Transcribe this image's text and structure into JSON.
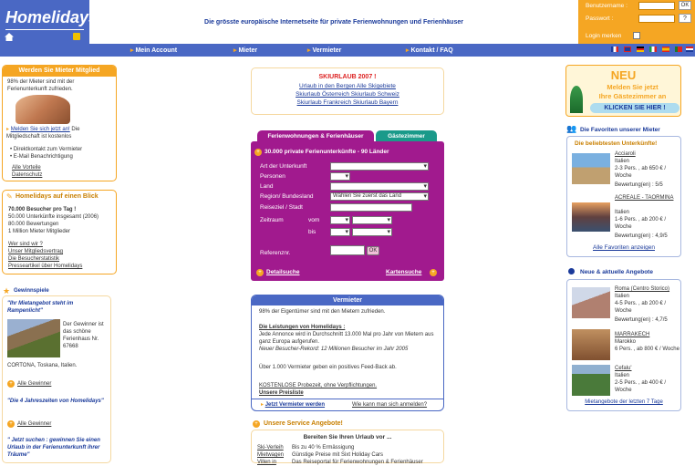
{
  "header": {
    "logo_text": "Homelidays",
    "tagline": "Die grösste europäische Internetseite für private Ferienwohnungen und Ferienhäuser",
    "login": {
      "username_label": "Benutzername :",
      "password_label": "Passwort :",
      "remember_label": "Login merken",
      "ok": "OK",
      "help": "?"
    }
  },
  "nav": [
    "Mein Account",
    "Mieter",
    "Vermieter",
    "Kontakt / FAQ"
  ],
  "left": {
    "member_box": {
      "title": "Werden Sie Mieter Mitglied",
      "intro": "98% der Mieter sind mit der Ferienunterkunft zufrieden.",
      "signup_link": "Melden Sie sich jetzt an!",
      "signup_rest": "Die Mitgliedschaft ist kostenlos",
      "bullets": [
        "Direktkontakt zum Vermieter",
        "E-Mail Benachrichtigung"
      ],
      "links": [
        "Alle Vorteile",
        "Datenschutz"
      ]
    },
    "glance": {
      "title": "Homelidays auf einen Blick",
      "lines": [
        "70.000 Besucher pro Tag !",
        "50.000 Unterkünfte insgesamt (2006)",
        "80.000 Bewertungen",
        "1 Million Mieter Mitglieder"
      ],
      "links": [
        "Wer sind wir ?",
        "Unser Mitgliedsvertrag",
        "Die Besucherstatistik",
        "Presseartikel über Homelidays"
      ]
    },
    "winners": {
      "title": "Gewinnspiele",
      "quote1": "\"Ihr Mietangebot steht im Rampenlicht\"",
      "winner_text": "Der Gewinner ist das schöne Ferienhaus Nr. 67668",
      "location": "CORTONA, Toskana, Italien.",
      "all_link": "Alle Gewinner",
      "quote2": "\"Die 4 Jahreszeiten von Homelidays\"",
      "all_link2": "Alle Gewinner",
      "quote3": "\" Jetzt suchen : gewinnen Sie einen Urlaub in der Ferienunterkunft ihrer Träume\""
    }
  },
  "center": {
    "ski": {
      "title": "SKIURLAUB 2007 !",
      "lines": [
        "Urlaub in den Bergen  Alle Skigebiete",
        "Skiurlaub Österreich  Skiurlaub Schweiz",
        "Skiurlaub Frankreich  Skiurlaub Bayern"
      ]
    },
    "tabs": [
      "Ferienwohnungen & Ferienhäuser",
      "Gästezimmer"
    ],
    "search": {
      "count": "30.000 private Ferienunterkünfte - 90 Länder",
      "labels": [
        "Art der Unterkunft",
        "Personen",
        "Land",
        "Region/ Bundesland",
        "Reiseziel / Stadt",
        "Zeitraum",
        "Referenznr."
      ],
      "vom": "vom",
      "bis": "bis",
      "region_select": "Wählen Sie zuerst das Land",
      "ok": "OK",
      "detail": "Detailsuche",
      "map": "Kartensuche"
    },
    "vermieter": {
      "title": "Vermieter",
      "intro": "98% der Eigentümer sind mit den Mietern zufrieden.",
      "leistungen": "Die Leistungen von Homelidays :",
      "text1": "Jede Annonce wird in Durchschnitt 13.000 Mal pro Jahr von Mietern aus ganz Europa aufgerufen.",
      "text2": "Neuer Besucher-Rekord: 12 Millionen Besucher im Jahr 2005",
      "text3": "Über 1.000 Vermieter geben ein positives Feed-Back ab.",
      "probe": "KOSTENLOSE Probezeit, ohne Verpflichtungen.",
      "prices": "Unsere Preisliste",
      "cta": "Jetzt Vermieter werden",
      "how": "Wie kann man sich anmelden?"
    },
    "service": {
      "title": "Unsere Service Angebote!",
      "subtitle": "Bereiten Sie Ihren Urlaub vor ...",
      "row1_a": "Ski-Verleih",
      "row1_b": "Bis zu 40 % Ermässigung",
      "row2_a": "Mietwagen",
      "row2_b": "Günstige Preise mit Sixt Holiday Cars",
      "row3_a": "Villen in",
      "row3_b": "Das Reiseportal für Ferienwohnungen & Ferienhäuser"
    }
  },
  "right": {
    "promo": {
      "new": "NEU",
      "line1": "Melden Sie jetzt",
      "line2": "Ihre Gästezimmer an",
      "cta": "KLICKEN SIE HIER !"
    },
    "favorites": {
      "title": "Die Favoriten unserer Mieter",
      "subtitle": "Die beliebtesten Unterkünfte!",
      "items": [
        {
          "name": "Acciaroli",
          "country": "Italien",
          "desc": "2-3 Pers. , ab 650 € / Woche",
          "rating": "Bewertung(en) : 5/5"
        },
        {
          "name": "ACREALE - TAORMINA",
          "country": "Italien",
          "desc": "1-6 Pers. , ab 200 € / Woche",
          "rating": "Bewertung(en) : 4,9/5"
        }
      ],
      "all": "Alle Favoriten anzeigen"
    },
    "news": {
      "title": "Neue & aktuelle Angebote",
      "items": [
        {
          "name": "Roma (Centro Storico)",
          "country": "Italien",
          "desc": "4-5 Pers. , ab 200 € / Woche",
          "rating": "Bewertung(en) : 4,7/5"
        },
        {
          "name": "MARRAKECH",
          "country": "Marokko",
          "desc": "6 Pers. , ab 800 € / Woche",
          "rating": ""
        },
        {
          "name": "Cefalu'",
          "country": "Italien",
          "desc": "2-5 Pers. , ab 400 € / Woche",
          "rating": ""
        }
      ],
      "all": "Mietangebote der letzten 7 Tage"
    }
  }
}
